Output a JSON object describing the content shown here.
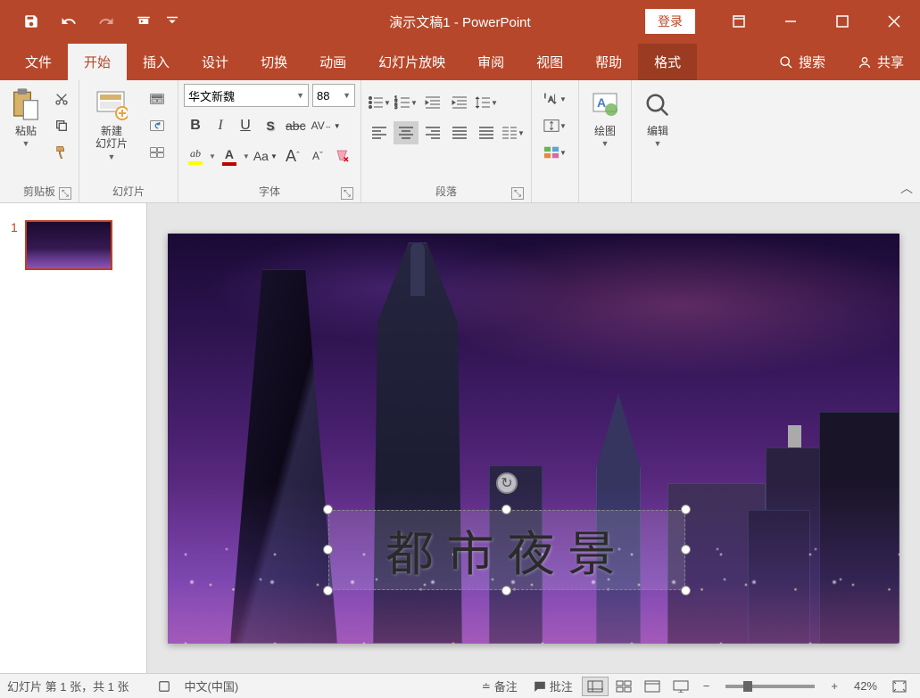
{
  "titlebar": {
    "title": "演示文稿1 - PowerPoint",
    "login": "登录"
  },
  "tabs": {
    "file": "文件",
    "home": "开始",
    "insert": "插入",
    "design": "设计",
    "transition": "切换",
    "animation": "动画",
    "slideshow": "幻灯片放映",
    "review": "审阅",
    "view": "视图",
    "help": "帮助",
    "format": "格式",
    "search": "搜索",
    "share": "共享"
  },
  "ribbon": {
    "clipboard": {
      "label": "剪贴板",
      "paste": "粘贴"
    },
    "slides": {
      "label": "幻灯片",
      "new_slide": "新建\n幻灯片"
    },
    "font": {
      "label": "字体",
      "name": "华文新魏",
      "size": "88",
      "bold": "B",
      "italic": "I",
      "underline": "U",
      "shadow": "S",
      "strike": "abc",
      "spacing": "AV",
      "caps": "Aa",
      "grow": "A",
      "shrink": "A"
    },
    "paragraph": {
      "label": "段落"
    },
    "drawing": {
      "label": "绘图"
    },
    "editing": {
      "label": "编辑"
    }
  },
  "slide": {
    "thumb_number": "1",
    "textbox_content": "都市夜景"
  },
  "status": {
    "slide_info": "幻灯片 第 1 张，共 1 张",
    "language": "中文(中国)",
    "notes": "备注",
    "comments": "批注",
    "zoom": "42%"
  }
}
